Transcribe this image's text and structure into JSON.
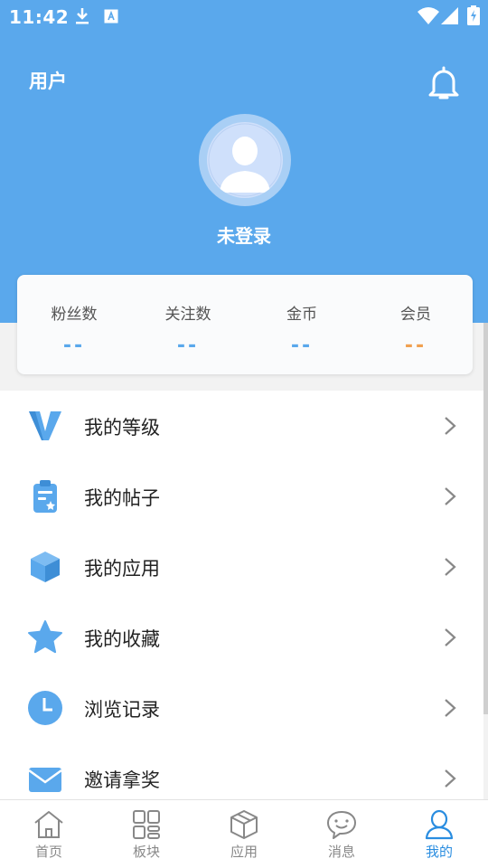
{
  "status_bar": {
    "time": "11:42"
  },
  "header": {
    "title": "用户",
    "login_status": "未登录"
  },
  "stats": [
    {
      "label": "粉丝数",
      "value": "--"
    },
    {
      "label": "关注数",
      "value": "--"
    },
    {
      "label": "金币",
      "value": "--"
    },
    {
      "label": "会员",
      "value": "--"
    }
  ],
  "menu": [
    {
      "label": "我的等级",
      "icon": "level-v-icon"
    },
    {
      "label": "我的帖子",
      "icon": "clipboard-icon"
    },
    {
      "label": "我的应用",
      "icon": "cube-icon"
    },
    {
      "label": "我的收藏",
      "icon": "star-icon"
    },
    {
      "label": "浏览记录",
      "icon": "clock-icon"
    },
    {
      "label": "邀请拿奖",
      "icon": "envelope-icon"
    }
  ],
  "tabs": [
    {
      "label": "首页",
      "icon": "home-icon"
    },
    {
      "label": "板块",
      "icon": "grid-icon"
    },
    {
      "label": "应用",
      "icon": "cube-outline-icon"
    },
    {
      "label": "消息",
      "icon": "chat-icon"
    },
    {
      "label": "我的",
      "icon": "user-icon",
      "active": true
    }
  ],
  "colors": {
    "primary": "#5aa8ec",
    "accent_orange": "#f0a050",
    "tab_active": "#2a8de0"
  }
}
